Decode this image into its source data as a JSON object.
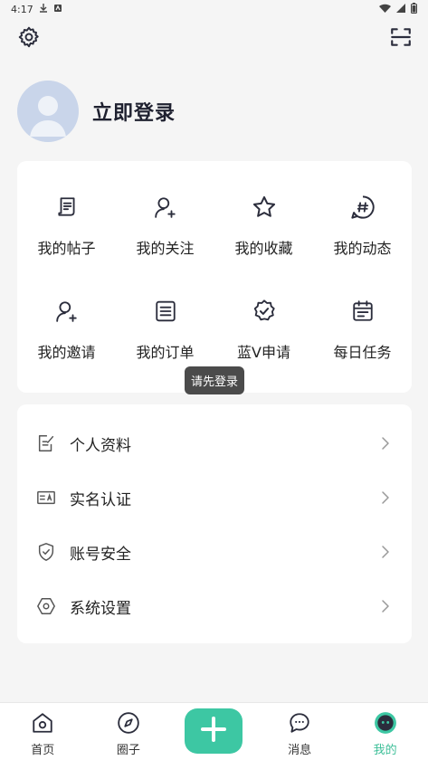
{
  "status_bar": {
    "time": "4:17"
  },
  "profile": {
    "login_label": "立即登录"
  },
  "quick_grid": [
    {
      "label": "我的帖子",
      "icon": "post-icon"
    },
    {
      "label": "我的关注",
      "icon": "follow-icon"
    },
    {
      "label": "我的收藏",
      "icon": "star-icon"
    },
    {
      "label": "我的动态",
      "icon": "hashtag-icon"
    },
    {
      "label": "我的邀请",
      "icon": "invite-icon"
    },
    {
      "label": "我的订单",
      "icon": "order-icon"
    },
    {
      "label": "蓝V申请",
      "icon": "verified-badge-icon"
    },
    {
      "label": "每日任务",
      "icon": "calendar-icon"
    }
  ],
  "tooltip": "请先登录",
  "settings_list": [
    {
      "label": "个人资料",
      "icon": "edit-profile-icon"
    },
    {
      "label": "实名认证",
      "icon": "id-card-icon"
    },
    {
      "label": "账号安全",
      "icon": "shield-icon"
    },
    {
      "label": "系统设置",
      "icon": "hex-settings-icon"
    }
  ],
  "bottom_nav": [
    {
      "label": "首页",
      "icon": "home-icon"
    },
    {
      "label": "圈子",
      "icon": "compass-icon"
    },
    {
      "label": "",
      "icon": "plus-icon"
    },
    {
      "label": "消息",
      "icon": "message-icon"
    },
    {
      "label": "我的",
      "icon": "me-icon"
    }
  ],
  "colors": {
    "accent": "#3dc7a3",
    "active_text": "#3dbf98",
    "icon": "#2b2d3c"
  }
}
